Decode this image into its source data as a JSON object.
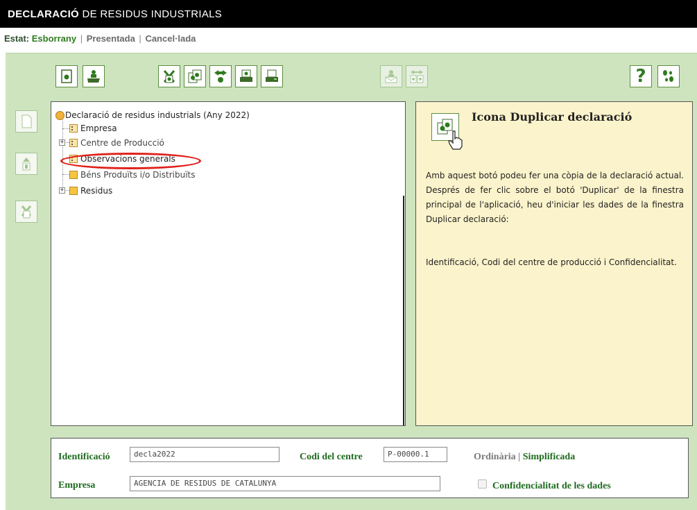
{
  "header": {
    "title_bold": "DECLARACIÓ",
    "title_rest": " DE RESIDUS INDUSTRIALS"
  },
  "status": {
    "label": "Estat:",
    "current": "Esborrany",
    "sep": "|",
    "option2": "Presentada",
    "option3": "Cancel·lada"
  },
  "toolbar": {
    "buttons": [
      "new-declaration-icon",
      "open-folder-icon",
      "delete-icon",
      "duplicate-icon",
      "transfer-icon",
      "print-preview-icon",
      "print-icon",
      "send-mail-icon",
      "compare-icon",
      "help-icon",
      "steps-icon"
    ],
    "help_glyph": "?"
  },
  "tree": {
    "root": "Declaració de residus industrials (Any 2022)",
    "items": [
      "Empresa",
      "Centre de Producció",
      "Observacions generals",
      "Béns Produïts i/o Distribuïts",
      "Residus"
    ]
  },
  "help": {
    "title": "Icona Duplicar declaració",
    "p1": "Amb aquest botó podeu fer una còpia de la declaració actual. Després de fer clic sobre el botó 'Duplicar' de la finestra principal de l'aplicació, heu d'iniciar les dades de la finestra Duplicar declaració:",
    "p2": "Identificació, Codi del centre de producció i Confidencialitat."
  },
  "form": {
    "id_label": "Identificació",
    "id_value": "decla2022",
    "code_label": "Codi del centre",
    "code_value": "P-00000.1",
    "type_option1": "Ordinària",
    "type_sep": "|",
    "type_option2": "Simplificada",
    "company_label": "Empresa",
    "company_value": "AGENCIA DE RESIDUS DE CATALUNYA",
    "confidential_label": "Confidencialitat de les dades"
  },
  "colors": {
    "app_bg": "#cee4bf",
    "help_bg": "#fbf3cb",
    "accent_green": "#2f7a1f",
    "highlight_red": "#e0201a"
  }
}
